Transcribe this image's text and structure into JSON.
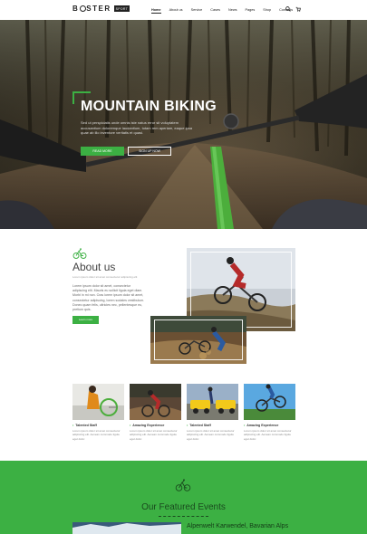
{
  "header": {
    "logo_text_start": "B",
    "logo_text_end": "STER",
    "logo_tag": "SPORT",
    "nav": [
      "Home",
      "About us",
      "Service",
      "Cases",
      "News",
      "Pages",
      "Shop",
      "Contacts"
    ]
  },
  "hero": {
    "title": "MOUNTAIN BIKING",
    "text": "Sed ut perspiciatis unde omnis iste natus error sit voluptatem accusantium doloremque laudantium, totam rem aperiam, eaque ipsa quae ab illo inventore veritatis et quasi.",
    "btn_primary": "READ MORE",
    "btn_secondary": "SIGN UP NOW"
  },
  "about": {
    "title": "About us",
    "subtitle": "Lorem ipsum dolor sit amet consectetur adipiscing elit",
    "text": "Lorem ipsum dolor sit amet, consectetur adipiscing elit. Mauris eu sollicit ligula eget diam. Morbi in mi non. Cras lorem ipsum dolor sit amet, consectetur adipiscing, lorem sodales vestibulum. Donec quam felis, ultricies nec, pellentesque eu, pretium quis.",
    "button": "Learn more"
  },
  "cards": [
    {
      "title": "Talented Staff",
      "text": "Lorem ipsum dolor sit amet consectetur adipiscing elit. Aenean commodo ligula eget dolor."
    },
    {
      "title": "Amazing Experience",
      "text": "Lorem ipsum dolor sit amet consectetur adipiscing elit. Aenean commodo ligula eget dolor."
    },
    {
      "title": "Talented Staff",
      "text": "Lorem ipsum dolor sit amet consectetur adipiscing elit. Aenean commodo ligula eget dolor."
    },
    {
      "title": "Amazing Experience",
      "text": "Lorem ipsum dolor sit amet consectetur adipiscing elit. Aenean commodo ligula eget dolor."
    }
  ],
  "featured": {
    "title": "Our Featured Events",
    "event_title": "Alpenwelt Karwendel, Bavarian Alps"
  },
  "colors": {
    "accent": "#3cb043",
    "dark": "#222222"
  },
  "icons": [
    "search-icon",
    "cart-icon",
    "bike-icon"
  ]
}
